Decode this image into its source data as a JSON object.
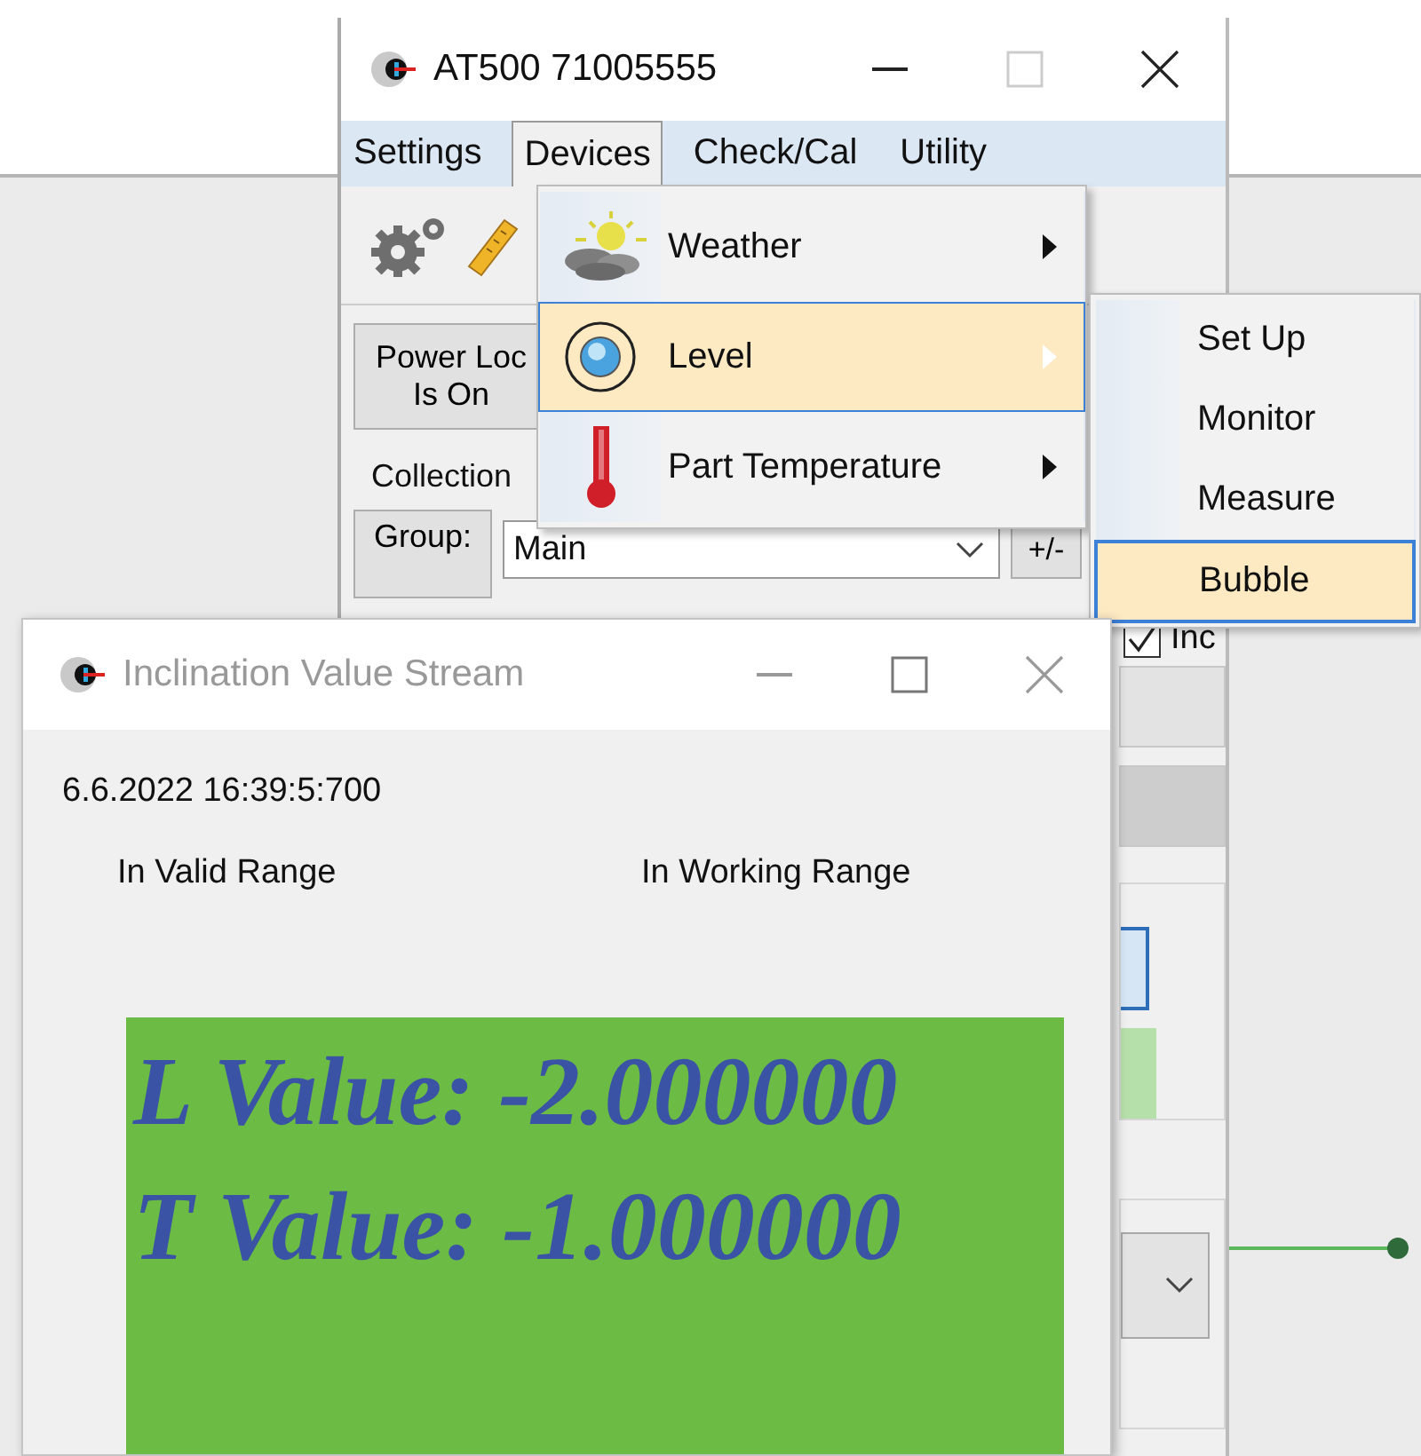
{
  "main_window": {
    "title": "AT500 71005555",
    "menu": [
      {
        "label": "Settings",
        "selected": false
      },
      {
        "label": "Devices",
        "selected": true
      },
      {
        "label": "Check/Cal",
        "selected": false
      },
      {
        "label": "Utility",
        "selected": false
      }
    ],
    "power_button": [
      "Power Loc",
      "Is On"
    ],
    "collection_label": "Collection",
    "group_button": "Group:",
    "group_select": {
      "value": "Main"
    },
    "plus_minus_button": "+/-",
    "inc_checkbox": {
      "label": "Inc",
      "checked": true
    }
  },
  "devices_menu": {
    "items": [
      {
        "label": "Weather",
        "kind": "weather",
        "selected": false
      },
      {
        "label": "Level",
        "kind": "level",
        "selected": true
      },
      {
        "label": "Part Temperature",
        "kind": "temperature",
        "selected": false
      }
    ]
  },
  "level_submenu": {
    "items": [
      {
        "label": "Set Up",
        "selected": false
      },
      {
        "label": "Monitor",
        "selected": false
      },
      {
        "label": "Measure",
        "selected": false
      },
      {
        "label": "Bubble",
        "selected": true
      }
    ]
  },
  "inclination_window": {
    "title": "Inclination Value Stream",
    "active": false,
    "timestamp": "6.6.2022 16:39:5:700",
    "status_labels": [
      "In Valid Range",
      "In Working Range"
    ],
    "readings": [
      "L Value: -2.000000",
      "T Value: -1.000000"
    ]
  }
}
